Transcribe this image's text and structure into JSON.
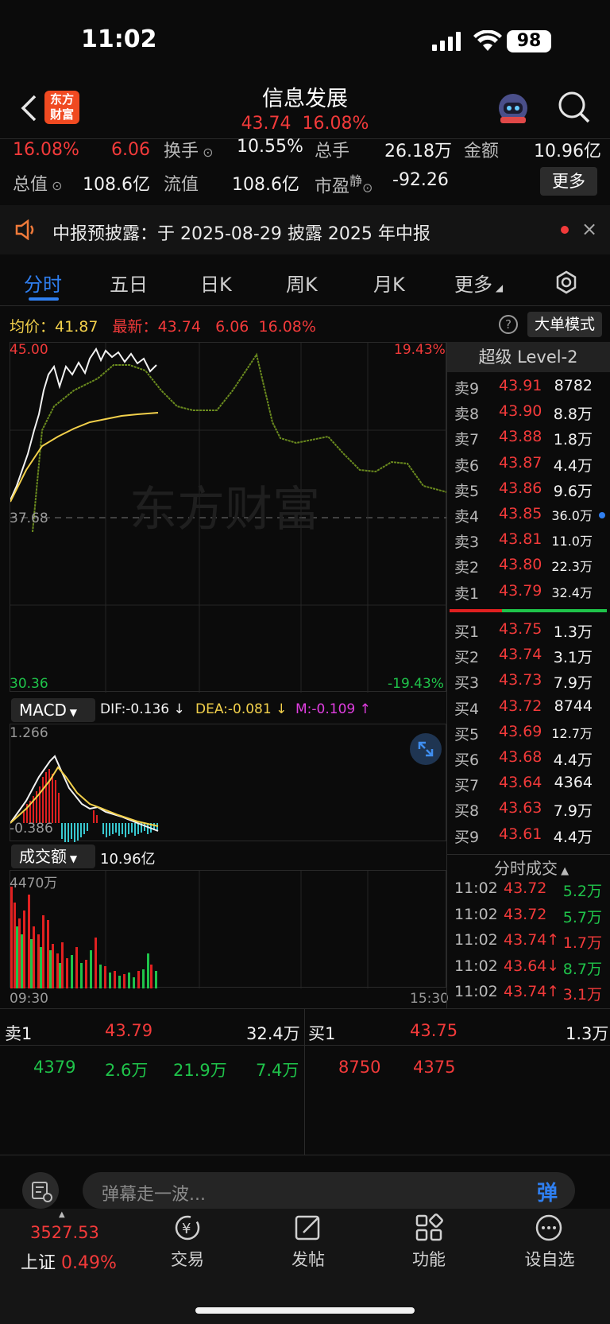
{
  "status_bar": {
    "time": "11:02",
    "battery": "98"
  },
  "header": {
    "title": "信息发展",
    "price": "43.74",
    "change_pct": "16.08%",
    "logo_line1": "东方",
    "logo_line2": "财富"
  },
  "stats": {
    "row1": {
      "pct": "16.08%",
      "chg": "6.06",
      "turnover_label": "换手",
      "turnover": "10.55%",
      "vol_label": "总手",
      "vol": "26.18万",
      "amt_label": "金额",
      "amt": "10.96亿"
    },
    "row2": {
      "mktcap_label": "总值",
      "mktcap": "108.6亿",
      "float_label": "流值",
      "float": "108.6亿",
      "pe_label": "市盈",
      "pe_sup": "静",
      "pe": "-92.26",
      "more": "更多"
    }
  },
  "notice": {
    "text": "中报预披露：于 2025-08-29 披露 2025 年中报"
  },
  "tabs": [
    "分时",
    "五日",
    "日K",
    "周K",
    "月K",
    "更多"
  ],
  "chart_info": {
    "avg_label": "均价：",
    "avg": "41.87",
    "last_label": "最新：",
    "last": "43.74",
    "chg": "6.06",
    "pct": "16.08%",
    "big_order": "大单模式"
  },
  "main_chart": {
    "max": "45.00",
    "max_pct": "19.43%",
    "mid": "37.68",
    "min": "30.36",
    "min_pct": "-19.43%",
    "watermark": "东方财富"
  },
  "macd": {
    "label": "MACD",
    "dif": "DIF:-0.136 ↓",
    "dea": "DEA:-0.081 ↓",
    "m": "M:-0.109 ↑",
    "max": "1.266",
    "min": "-0.386"
  },
  "volume": {
    "label": "成交额",
    "value": "10.96亿",
    "max": "4470万",
    "start": "09:30",
    "end": "15:30"
  },
  "level2": {
    "title": "超级 Level-2",
    "asks": [
      {
        "label": "卖9",
        "price": "43.91",
        "vol": "8782"
      },
      {
        "label": "卖8",
        "price": "43.90",
        "vol": "8.8万"
      },
      {
        "label": "卖7",
        "price": "43.88",
        "vol": "1.8万"
      },
      {
        "label": "卖6",
        "price": "43.87",
        "vol": "4.4万"
      },
      {
        "label": "卖5",
        "price": "43.86",
        "vol": "9.6万"
      },
      {
        "label": "卖4",
        "price": "43.85",
        "vol": "36.0万"
      },
      {
        "label": "卖3",
        "price": "43.81",
        "vol": "11.0万"
      },
      {
        "label": "卖2",
        "price": "43.80",
        "vol": "22.3万"
      },
      {
        "label": "卖1",
        "price": "43.79",
        "vol": "32.4万"
      }
    ],
    "bids": [
      {
        "label": "买1",
        "price": "43.75",
        "vol": "1.3万"
      },
      {
        "label": "买2",
        "price": "43.74",
        "vol": "3.1万"
      },
      {
        "label": "买3",
        "price": "43.73",
        "vol": "7.9万"
      },
      {
        "label": "买4",
        "price": "43.72",
        "vol": "8744"
      },
      {
        "label": "买5",
        "price": "43.69",
        "vol": "12.7万"
      },
      {
        "label": "买6",
        "price": "43.68",
        "vol": "4.4万"
      },
      {
        "label": "买7",
        "price": "43.64",
        "vol": "4364"
      },
      {
        "label": "买8",
        "price": "43.63",
        "vol": "7.9万"
      },
      {
        "label": "买9",
        "price": "43.61",
        "vol": "4.4万"
      }
    ],
    "ticks_title": "分时成交",
    "ticks": [
      {
        "time": "11:02",
        "price": "43.72",
        "vol": "5.2万",
        "color": "green"
      },
      {
        "time": "11:02",
        "price": "43.72",
        "vol": "5.7万",
        "color": "green"
      },
      {
        "time": "11:02",
        "price": "43.74↑",
        "vol": "1.7万",
        "color": "red"
      },
      {
        "time": "11:02",
        "price": "43.64↓",
        "vol": "8.7万",
        "color": "green"
      },
      {
        "time": "11:02",
        "price": "43.74↑",
        "vol": "3.1万",
        "color": "red"
      }
    ]
  },
  "bottom_quote": {
    "ask_label": "卖1",
    "ask_price": "43.79",
    "ask_vol": "32.4万",
    "bid_label": "买1",
    "bid_price": "43.75",
    "bid_vol": "1.3万",
    "ask_details": [
      "4379",
      "2.6万",
      "21.9万",
      "7.4万"
    ],
    "bid_details": [
      "8750",
      "4375"
    ]
  },
  "danmaku": {
    "placeholder": "弹幕走一波...",
    "btn": "弹"
  },
  "bottom_nav": {
    "index_value": "3527.53",
    "index_name": "上证",
    "index_pct": "0.49%",
    "items": [
      "交易",
      "发帖",
      "功能",
      "设自选"
    ]
  }
}
